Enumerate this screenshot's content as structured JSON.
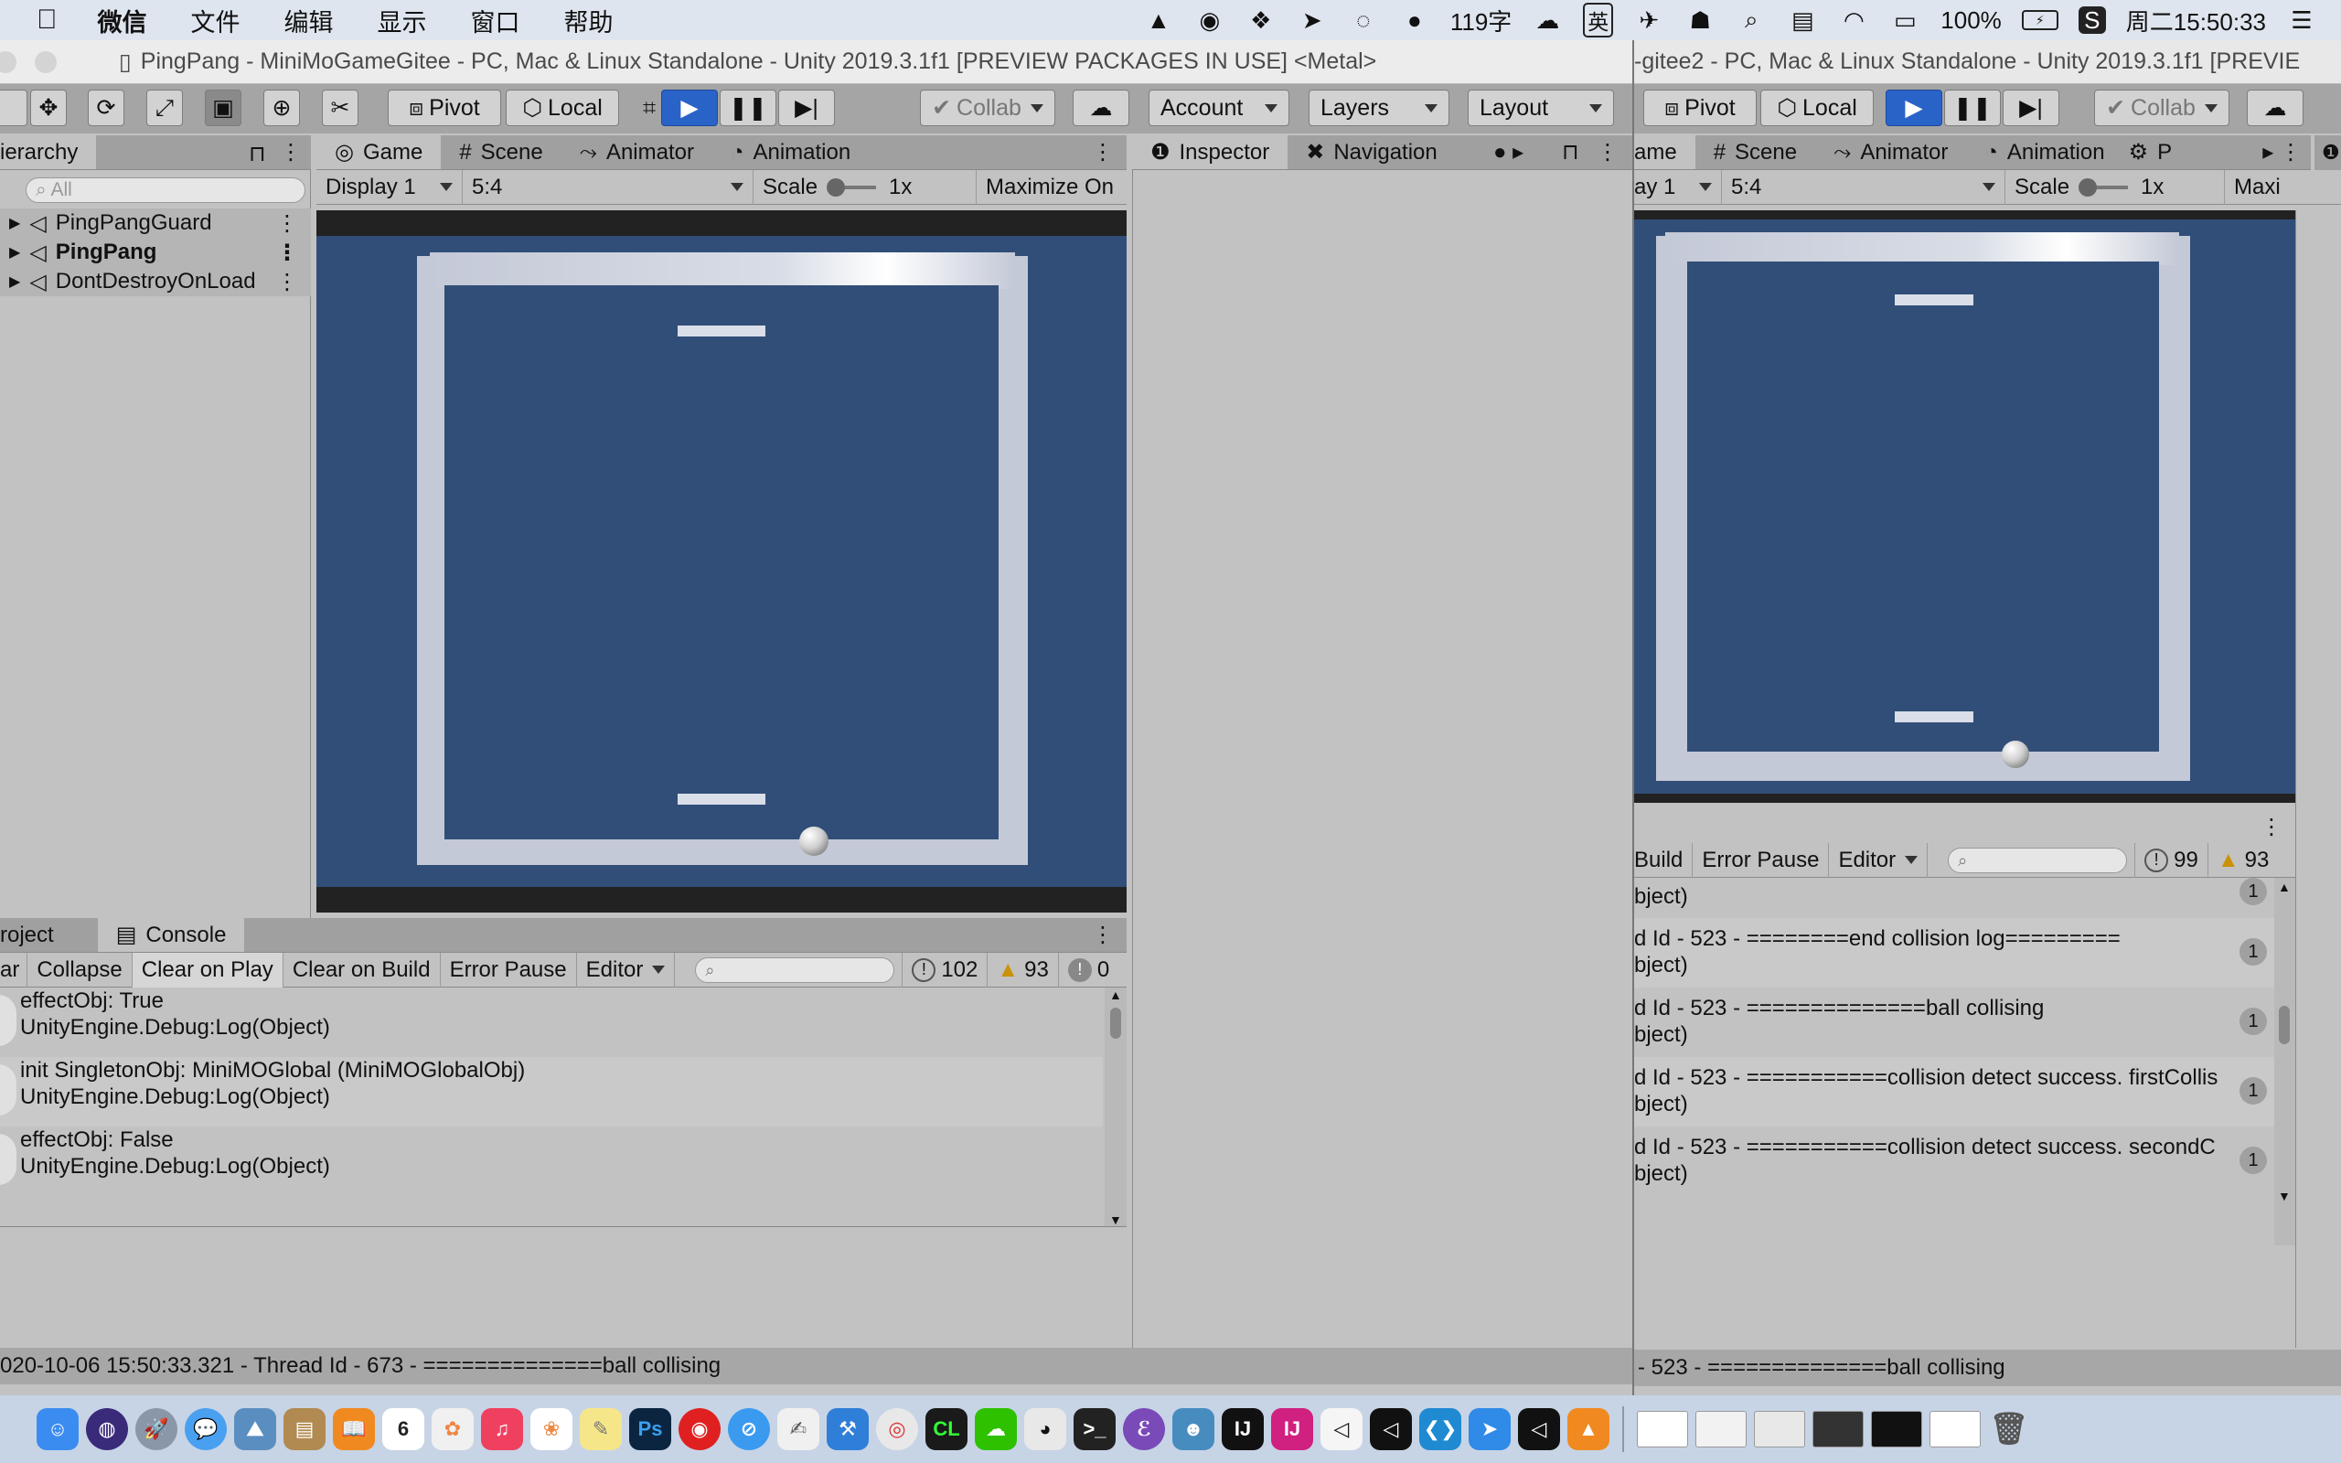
{
  "menubar": {
    "app_name": "微信",
    "items": [
      "文件",
      "编辑",
      "显示",
      "窗口",
      "帮助"
    ],
    "word_count": "119字",
    "input_method": "英",
    "battery": "100%",
    "clock": "周二15:50:33"
  },
  "left_window": {
    "title": "PingPang - MiniMoGameGitee - PC, Mac & Linux Standalone - Unity 2019.3.1f1 [PREVIEW PACKAGES IN USE] <Metal>",
    "toolbar": {
      "pivot": "Pivot",
      "local": "Local",
      "collab": "Collab",
      "account": "Account",
      "layers": "Layers",
      "layout": "Layout"
    },
    "hierarchy": {
      "tab_label": "ierarchy",
      "search_placeholder": "All",
      "items": [
        {
          "label": "PingPangGuard"
        },
        {
          "label": "PingPang"
        },
        {
          "label": "DontDestroyOnLoad"
        }
      ]
    },
    "game_tabs": [
      "Game",
      "Scene",
      "Animator",
      "Animation"
    ],
    "game_options": {
      "display": "Display 1",
      "aspect": "5:4",
      "scale_label": "Scale",
      "scale_value": "1x",
      "maximize": "Maximize On"
    },
    "inspector_tabs": [
      "Inspector",
      "Navigation"
    ],
    "console": {
      "tabs": [
        "roject",
        "Console"
      ],
      "toolbar": [
        "ar",
        "Collapse",
        "Clear on Play",
        "Clear on Build",
        "Error Pause",
        "Editor"
      ],
      "counts": {
        "info": "102",
        "warn": "93",
        "error": "0"
      },
      "entries": [
        {
          "line1": "effectObj: True",
          "line2": "UnityEngine.Debug:Log(Object)"
        },
        {
          "line1": "init SingletonObj: MiniMOGlobal (MiniMOGlobalObj)",
          "line2": "UnityEngine.Debug:Log(Object)"
        },
        {
          "line1": "effectObj: False",
          "line2": "UnityEngine.Debug:Log(Object)"
        }
      ]
    },
    "status_bar": "020-10-06 15:50:33.321 - Thread Id - 673 - ==============ball collising"
  },
  "right_window": {
    "title": "-gitee2 - PC, Mac & Linux Standalone - Unity 2019.3.1f1 [PREVIE",
    "toolbar": {
      "pivot": "Pivot",
      "local": "Local",
      "collab": "Collab"
    },
    "game_tabs": [
      "ame",
      "Scene",
      "Animator",
      "Animation",
      "P"
    ],
    "game_options": {
      "display": "ay 1",
      "aspect": "5:4",
      "scale_label": "Scale",
      "scale_value": "1x",
      "maximize": "Maxi"
    },
    "console": {
      "toolbar": [
        "Build",
        "Error Pause",
        "Editor"
      ],
      "counts": {
        "info": "99",
        "warn": "93"
      },
      "entries": [
        {
          "line1": "d Id - 523 - ========end collision log=========",
          "line2": "bject)",
          "count": "1"
        },
        {
          "line1": "d Id - 523 - ==============ball collising",
          "line2": "bject)",
          "count": "1"
        },
        {
          "line1": "d Id - 523 - ===========collision detect success. firstCollis",
          "line2": "bject)",
          "count": "1"
        },
        {
          "line1": "d Id - 523 - ===========collision detect success. secondC",
          "line2": "bject)",
          "count": "1"
        }
      ],
      "partial_top": {
        "line2": "bject)",
        "count": "1"
      }
    },
    "status_bar": "- 523 - ==============ball collising"
  },
  "colors": {
    "game_bg": "#314e78",
    "frame": "#c4c9d7",
    "editor_bg": "#c2c2c2",
    "play_blue": "#2a63c8"
  },
  "dock_icons": [
    "finder-icon",
    "siri-icon",
    "launchpad-icon",
    "messages-icon",
    "preview-icon",
    "contacts-icon",
    "books-icon",
    "calendar-icon",
    "photos-icon",
    "music-icon",
    "photos2-icon",
    "notes-icon",
    "photoshop-icon",
    "netease-icon",
    "safari-icon",
    "textedit-icon",
    "xcode-icon",
    "chrome-icon",
    "clion-icon",
    "wechat-icon",
    "qq-icon",
    "terminal-icon",
    "emacs-icon",
    "godot-icon",
    "intellij-icon",
    "intellij2-icon",
    "unity-icon",
    "unity2-icon",
    "vscode-icon",
    "feishu-icon",
    "unity3-icon",
    "vlc-icon",
    "window-thumb-icon",
    "window-thumb2-icon",
    "window-thumb3-icon",
    "window-thumb4-icon",
    "window-thumb5-icon",
    "window-thumb6-icon",
    "trash-icon"
  ],
  "calendar_day": "6"
}
